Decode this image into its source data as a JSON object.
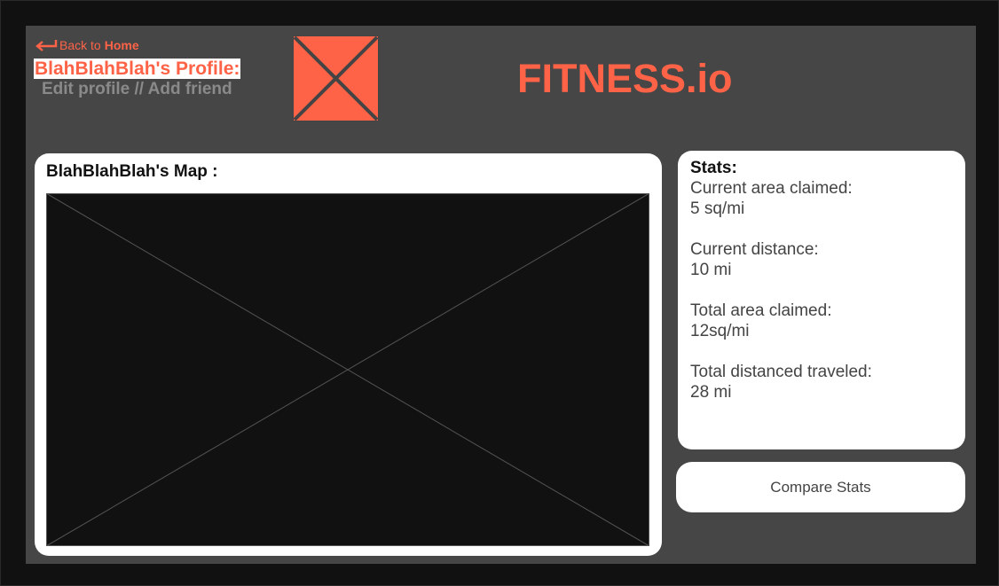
{
  "header": {
    "back_prefix": "Back to",
    "back_home": "Home",
    "profile_title": "BlahBlahBlah's Profile:",
    "profile_actions": "Edit profile // Add friend",
    "brand": "FITNESS.io",
    "icons": {
      "back": "return-arrow-icon",
      "avatar": "image-placeholder-icon"
    }
  },
  "map": {
    "title": "BlahBlahBlah's Map :"
  },
  "stats": {
    "heading": "Stats:",
    "items": [
      {
        "label": "Current area claimed:",
        "value": "5 sq/mi"
      },
      {
        "label": "Current distance:",
        "value": "10 mi"
      },
      {
        "label": "Total area claimed:",
        "value": "12sq/mi"
      },
      {
        "label": "Total distanced traveled:",
        "value": "28 mi"
      }
    ]
  },
  "actions": {
    "compare_label": "Compare Stats"
  },
  "colors": {
    "accent": "#ff6347",
    "panel": "#464646",
    "background": "#111111",
    "muted_text": "#8a8a8a"
  }
}
